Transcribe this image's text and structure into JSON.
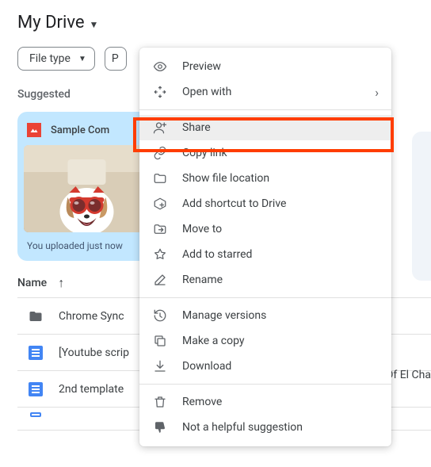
{
  "header": {
    "title": "My Drive"
  },
  "chips": {
    "file_type": "File type",
    "second": "P"
  },
  "suggested_label": "Suggested",
  "card": {
    "title": "Sample Com",
    "footer": "You uploaded just now"
  },
  "list": {
    "name_header": "Name",
    "rows": [
      {
        "label": "Chrome Sync",
        "icon": "folder"
      },
      {
        "label": "[Youtube scrip",
        "icon": "doc"
      },
      {
        "label": "2nd template",
        "icon": "doc"
      }
    ],
    "row2_extra": "Of El Cha"
  },
  "menu": {
    "items": [
      {
        "icon": "eye",
        "label": "Preview"
      },
      {
        "icon": "open-with",
        "label": "Open with",
        "submenu": true
      },
      {
        "sep": true
      },
      {
        "icon": "person-add",
        "label": "Share",
        "highlight": true
      },
      {
        "icon": "link",
        "label": "Copy link"
      },
      {
        "icon": "folder-outline",
        "label": "Show file location"
      },
      {
        "icon": "shortcut",
        "label": "Add shortcut to Drive"
      },
      {
        "icon": "move",
        "label": "Move to"
      },
      {
        "icon": "star",
        "label": "Add to starred"
      },
      {
        "icon": "pencil",
        "label": "Rename"
      },
      {
        "sep": true
      },
      {
        "icon": "history",
        "label": "Manage versions"
      },
      {
        "icon": "copy",
        "label": "Make a copy"
      },
      {
        "icon": "download",
        "label": "Download"
      },
      {
        "sep": true
      },
      {
        "icon": "trash",
        "label": "Remove"
      },
      {
        "icon": "thumb-down",
        "label": "Not a helpful suggestion"
      }
    ]
  }
}
